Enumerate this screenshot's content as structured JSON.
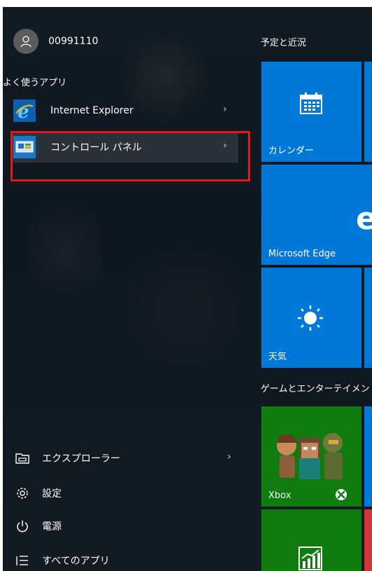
{
  "user": {
    "name": "00991110"
  },
  "frequent": {
    "title": "よく使うアプリ",
    "items": [
      {
        "label": "Internet Explorer"
      },
      {
        "label": "コントロール パネル"
      }
    ]
  },
  "bottom": {
    "explorer": "エクスプローラー",
    "settings": "設定",
    "power": "電源",
    "all_apps": "すべてのアプリ"
  },
  "tiles": {
    "group1_title": "予定と近況",
    "calendar": "カレンダー",
    "edge": "Microsoft Edge",
    "weather": "天気",
    "group2_title": "ゲームとエンターテイメント",
    "xbox": "Xbox"
  },
  "colors": {
    "tile_blue": "#0078d7",
    "tile_green": "#107c10",
    "highlight_red": "#e0191b",
    "selected_bg": "#2a3138"
  }
}
